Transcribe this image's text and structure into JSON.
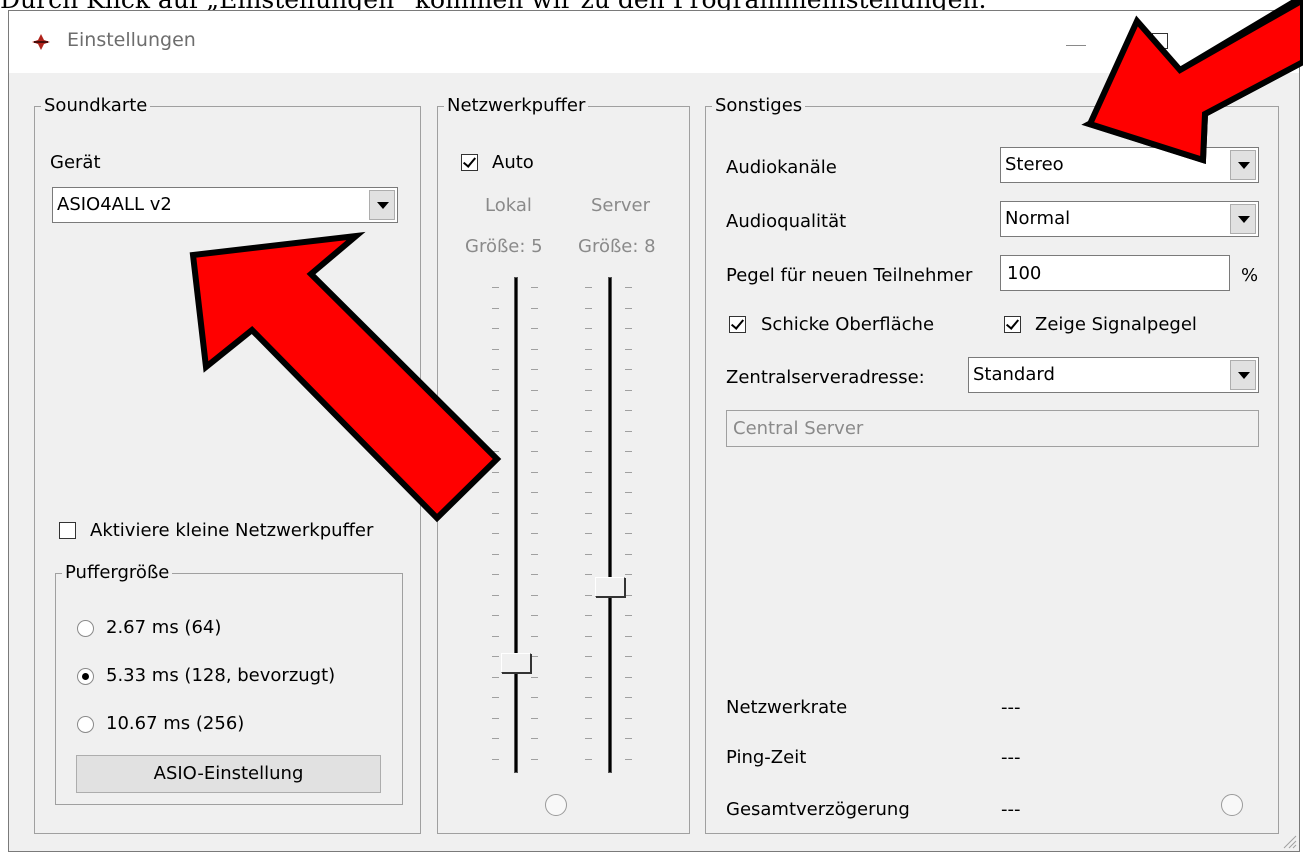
{
  "caption": "Durch Klick auf „Einstellungen“ kommen wir zu den Programmeinstellungen.",
  "window": {
    "title": "Einstellungen",
    "app_icon": "jamulus-logo-icon"
  },
  "soundcard": {
    "group_title": "Soundkarte",
    "device_label": "Gerät",
    "device_value": "ASIO4ALL v2",
    "small_buffers_label": "Aktiviere kleine Netzwerkpuffer",
    "small_buffers_checked": false,
    "buffer_group_title": "Puffergröße",
    "buffer_options": [
      "2.67 ms (64)",
      "5.33 ms (128, bevorzugt)",
      "10.67 ms (256)"
    ],
    "buffer_selected": 1,
    "asio_button": "ASIO-Einstellung"
  },
  "network_buffer": {
    "group_title": "Netzwerkpuffer",
    "auto_label": "Auto",
    "auto_checked": true,
    "local_label": "Lokal",
    "local_size": "Größe: 5",
    "server_label": "Server",
    "server_size": "Größe: 8"
  },
  "misc": {
    "group_title": "Sonstiges",
    "audio_channels_label": "Audiokanäle",
    "audio_channels_value": "Stereo",
    "audio_quality_label": "Audioqualität",
    "audio_quality_value": "Normal",
    "level_label": "Pegel für neuen Teilnehmer",
    "level_value": "100",
    "level_unit": "%",
    "fancy_skin_label": "Schicke Oberfläche",
    "fancy_skin_checked": true,
    "show_levels_label": "Zeige Signalpegel",
    "show_levels_checked": true,
    "central_server_label": "Zentralserveradresse:",
    "central_server_value": "Standard",
    "central_server_text": "Central Server",
    "net_rate_label": "Netzwerkrate",
    "net_rate_value": "---",
    "ping_label": "Ping-Zeit",
    "ping_value": "---",
    "total_delay_label": "Gesamtverzögerung",
    "total_delay_value": "---"
  },
  "colors": {
    "arrow": "#ff0000",
    "window_bg": "#f0f0f0",
    "titlebar": "#ffffff"
  }
}
